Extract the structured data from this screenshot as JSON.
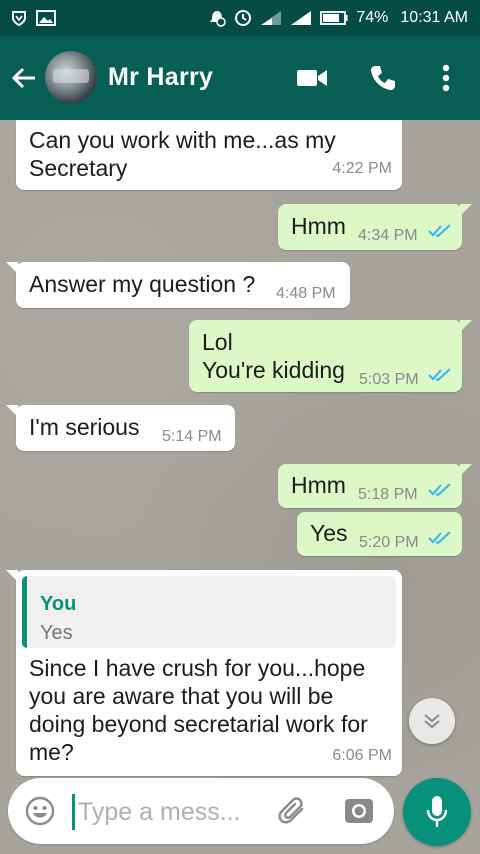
{
  "status_bar": {
    "battery": "74%",
    "time": "10:31 AM",
    "icons": [
      "shield-icon",
      "image-icon",
      "alarm-icon",
      "clock-icon",
      "signal-icon",
      "signal-icon",
      "battery-icon"
    ]
  },
  "header": {
    "contact_name": "Mr Harry",
    "icons": [
      "back-arrow-icon",
      "video-call-icon",
      "phone-icon",
      "more-vert-icon"
    ]
  },
  "messages": [
    {
      "direction": "incoming",
      "text": "Can you work with me...as my\nSecretary",
      "time": "4:22 PM"
    },
    {
      "direction": "outgoing",
      "text": "Hmm",
      "time": "4:34 PM",
      "status": "read"
    },
    {
      "direction": "incoming",
      "text": "Answer my question ?",
      "time": "4:48 PM"
    },
    {
      "direction": "outgoing",
      "text": "Lol\nYou're kidding",
      "time": "5:03 PM",
      "status": "read"
    },
    {
      "direction": "incoming",
      "text": "I'm serious",
      "time": "5:14 PM"
    },
    {
      "direction": "outgoing",
      "text": "Hmm",
      "time": "5:18 PM",
      "status": "read"
    },
    {
      "direction": "outgoing",
      "text": "Yes",
      "time": "5:20 PM",
      "status": "read"
    },
    {
      "direction": "incoming",
      "quoted": {
        "author": "You",
        "text": "Yes"
      },
      "text": "Since I have crush for you...hope\nyou are aware that you will be\ndoing beyond secretarial work for\nme?",
      "time": "6:06 PM"
    }
  ],
  "composer": {
    "placeholder": "Type a mess...",
    "value": ""
  },
  "colors": {
    "header": "#075e54",
    "status_bar": "#054d44",
    "outgoing_bubble": "#dcf8c6",
    "incoming_bubble": "#ffffff",
    "accent": "#07907a",
    "read_tick": "#34b7f1"
  }
}
